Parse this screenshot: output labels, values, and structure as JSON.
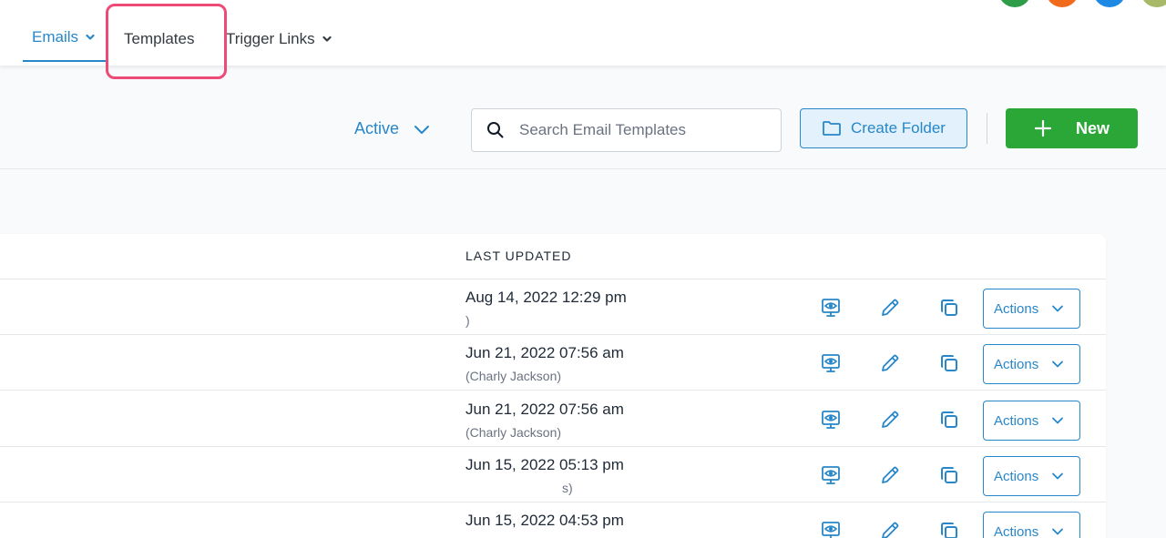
{
  "nav": {
    "items": [
      {
        "label": "Emails",
        "active": true
      },
      {
        "label": "Templates",
        "active": false
      },
      {
        "label": "Trigger Links",
        "active": false
      }
    ],
    "highlight_color": "#ee4a77"
  },
  "toolbar": {
    "status_filter": "Active",
    "search_placeholder": "Search Email Templates",
    "create_folder_label": "Create Folder",
    "new_label": "New"
  },
  "table": {
    "columns": [
      "LAST UPDATED"
    ],
    "rows": [
      {
        "date": "Aug 14, 2022 12:29 pm",
        "author": ")",
        "actions_label": "Actions"
      },
      {
        "date": "Jun 21, 2022 07:56 am",
        "author": "(Charly Jackson)",
        "actions_label": "Actions"
      },
      {
        "date": "Jun 21, 2022 07:56 am",
        "author": "(Charly Jackson)",
        "actions_label": "Actions"
      },
      {
        "date": "Jun 15, 2022 05:13 pm",
        "author": "s)",
        "actions_label": "Actions"
      },
      {
        "date": "Jun 15, 2022 04:53 pm",
        "author": "",
        "actions_label": "Actions"
      }
    ]
  },
  "colors": {
    "accent": "#2787c9",
    "primary_green": "#2ba738",
    "avatars": [
      "#2e9d4a",
      "#f26b1d",
      "#1e88e5",
      "#a8b96a"
    ]
  }
}
